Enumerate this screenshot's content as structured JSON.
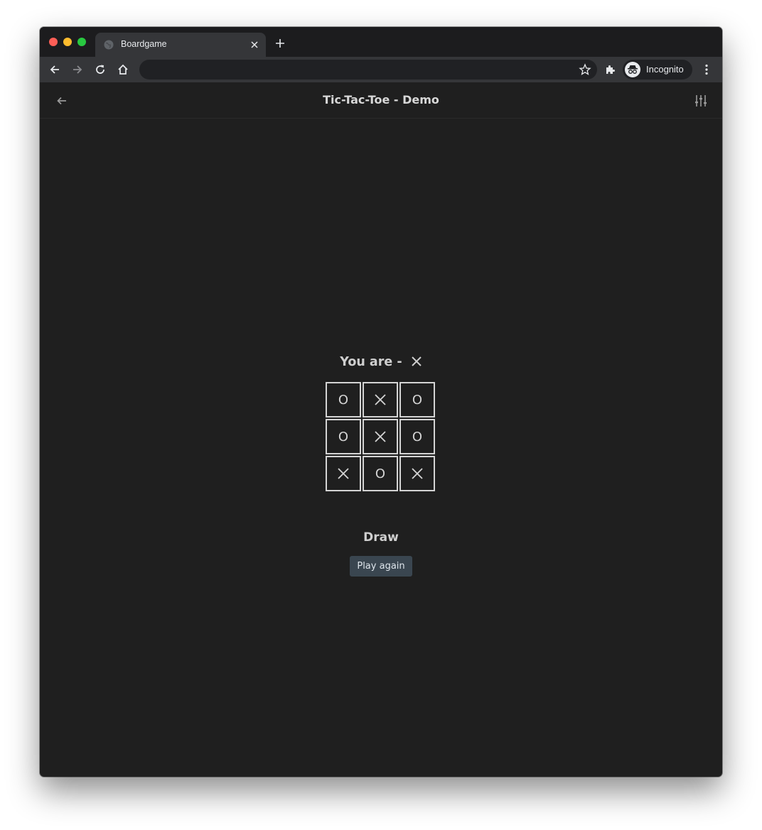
{
  "browser": {
    "tab_title": "Boardgame",
    "profile_label": "Incognito"
  },
  "header": {
    "title": "Tic-Tac-Toe - Demo"
  },
  "game": {
    "player_prefix": "You are -",
    "player_mark": "X",
    "board": [
      "O",
      "X",
      "O",
      "O",
      "X",
      "O",
      "X",
      "O",
      "X"
    ],
    "status": "Draw",
    "play_again_label": "Play again"
  },
  "icons": {
    "back": "arrow-left-icon",
    "forward": "arrow-right-icon",
    "reload": "reload-icon",
    "home": "home-icon",
    "bookmark": "star-icon",
    "extensions": "puzzle-icon",
    "menu": "kebab-menu-icon",
    "settings": "sliders-icon"
  },
  "colors": {
    "background": "#1f1f1f",
    "button": "#3a4650",
    "cell_border": "#d4d4d4"
  }
}
